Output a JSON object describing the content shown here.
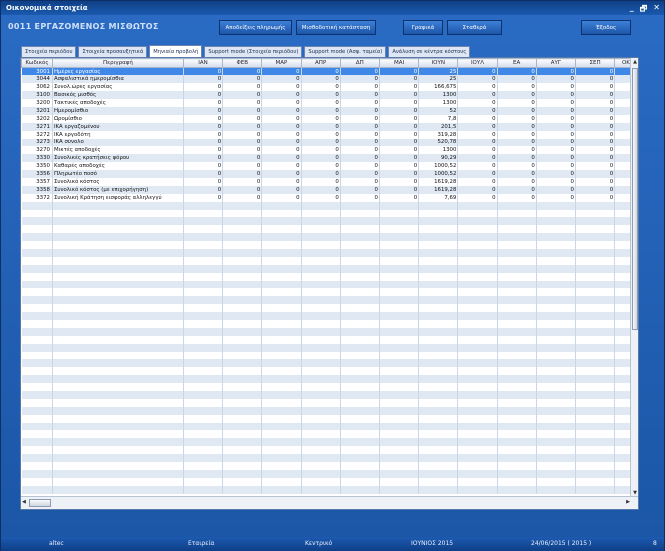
{
  "window": {
    "title": "Οικονομικά στοιχεία",
    "minimize": "_",
    "restore": "🗗",
    "close": "✕"
  },
  "header": {
    "form_title": "0011  ΕΡΓΑΖΟΜΕΝΟΣ ΜΙΣΘΩΤΟΣ",
    "buttons": {
      "receipts": "Αποδείξεις πληρωμής",
      "payroll": "Μισθοδοτική κατάσταση",
      "charts": "Γραφικά",
      "constants": "Σταθερά",
      "exit": "Έξοδος"
    }
  },
  "tabs": [
    "Στοιχεία περιόδου",
    "Στοιχεία προσαυξητικά",
    "Μηνιαία προβολή",
    "Support mode (Στοιχεία περιόδου)",
    "Support mode (Ασφ. ταμεία)",
    "Ανάλυση σε κέντρα κόστους"
  ],
  "table": {
    "columns": [
      "Κωδικός",
      "Περιγραφή",
      "ΙΑΝ",
      "ΦΕΒ",
      "ΜΑΡ",
      "ΑΠΡ",
      "ΔΠ",
      "ΜΑΙ",
      "ΙΟΥΝ",
      "ΙΟΥΛ",
      "ΕΑ",
      "ΑΥΓ",
      "ΣΕΠ",
      "ΟΚΤ"
    ],
    "rows": [
      {
        "code": "3001",
        "desc": "Ημέρες εργασίας",
        "vals": [
          "0",
          "0",
          "0",
          "0",
          "0",
          "0",
          "25",
          "0",
          "0",
          "0",
          "0",
          "0"
        ]
      },
      {
        "code": "3044",
        "desc": "Ασφαλιστικά ημερομίσθια",
        "vals": [
          "0",
          "0",
          "0",
          "0",
          "0",
          "0",
          "25",
          "0",
          "0",
          "0",
          "0",
          "0"
        ]
      },
      {
        "code": "3062",
        "desc": "Συνολ.ώρες εργασίας",
        "vals": [
          "0",
          "0",
          "0",
          "0",
          "0",
          "0",
          "166,675",
          "0",
          "0",
          "0",
          "0",
          "0"
        ]
      },
      {
        "code": "3100",
        "desc": "Βασικός μισθός",
        "vals": [
          "0",
          "0",
          "0",
          "0",
          "0",
          "0",
          "1300",
          "0",
          "0",
          "0",
          "0",
          "0"
        ]
      },
      {
        "code": "3200",
        "desc": "Τακτικές αποδοχές",
        "vals": [
          "0",
          "0",
          "0",
          "0",
          "0",
          "0",
          "1300",
          "0",
          "0",
          "0",
          "0",
          "0"
        ]
      },
      {
        "code": "3201",
        "desc": "Ημερομίσθιο",
        "vals": [
          "0",
          "0",
          "0",
          "0",
          "0",
          "0",
          "52",
          "0",
          "0",
          "0",
          "0",
          "0"
        ]
      },
      {
        "code": "3202",
        "desc": "Ωρομίσθιο",
        "vals": [
          "0",
          "0",
          "0",
          "0",
          "0",
          "0",
          "7,8",
          "0",
          "0",
          "0",
          "0",
          "0"
        ]
      },
      {
        "code": "3271",
        "desc": "ΙΚΑ εργαζομένου",
        "vals": [
          "0",
          "0",
          "0",
          "0",
          "0",
          "0",
          "201,5",
          "0",
          "0",
          "0",
          "0",
          "0"
        ]
      },
      {
        "code": "3272",
        "desc": "ΙΚΑ εργοδότη",
        "vals": [
          "0",
          "0",
          "0",
          "0",
          "0",
          "0",
          "319,28",
          "0",
          "0",
          "0",
          "0",
          "0"
        ]
      },
      {
        "code": "3273",
        "desc": "ΙΚΑ σύνολο",
        "vals": [
          "0",
          "0",
          "0",
          "0",
          "0",
          "0",
          "520,78",
          "0",
          "0",
          "0",
          "0",
          "0"
        ]
      },
      {
        "code": "3270",
        "desc": "Μικτές αποδοχές",
        "vals": [
          "0",
          "0",
          "0",
          "0",
          "0",
          "0",
          "1300",
          "0",
          "0",
          "0",
          "0",
          "0"
        ]
      },
      {
        "code": "3330",
        "desc": "Συνολικές κρατήσεις φόρου",
        "vals": [
          "0",
          "0",
          "0",
          "0",
          "0",
          "0",
          "90,29",
          "0",
          "0",
          "0",
          "0",
          "0"
        ]
      },
      {
        "code": "3350",
        "desc": "Καθαρές αποδοχές",
        "vals": [
          "0",
          "0",
          "0",
          "0",
          "0",
          "0",
          "1000,52",
          "0",
          "0",
          "0",
          "0",
          "0"
        ]
      },
      {
        "code": "3356",
        "desc": "Πληρωτέο ποσό",
        "vals": [
          "0",
          "0",
          "0",
          "0",
          "0",
          "0",
          "1000,52",
          "0",
          "0",
          "0",
          "0",
          "0"
        ]
      },
      {
        "code": "3357",
        "desc": "Συνολικό κόστος",
        "vals": [
          "0",
          "0",
          "0",
          "0",
          "0",
          "0",
          "1619,28",
          "0",
          "0",
          "0",
          "0",
          "0"
        ]
      },
      {
        "code": "3358",
        "desc": "Συνολικό κόστος (με επιχορήγηση)",
        "vals": [
          "0",
          "0",
          "0",
          "0",
          "0",
          "0",
          "1619,28",
          "0",
          "0",
          "0",
          "0",
          "0"
        ]
      },
      {
        "code": "3372",
        "desc": "Συνολική Κράτηση εισφοράς αλληλεγγύ",
        "vals": [
          "0",
          "0",
          "0",
          "0",
          "0",
          "0",
          "7,69",
          "0",
          "0",
          "0",
          "0",
          "0"
        ]
      }
    ]
  },
  "statusbar": {
    "company_code": "altec",
    "company": "Εταιρεία",
    "center": "Κεντρικό",
    "period": "ΙΟΥΝΙΟΣ 2015",
    "date": "24/06/2015 ( 2015 )",
    "count": "8"
  }
}
